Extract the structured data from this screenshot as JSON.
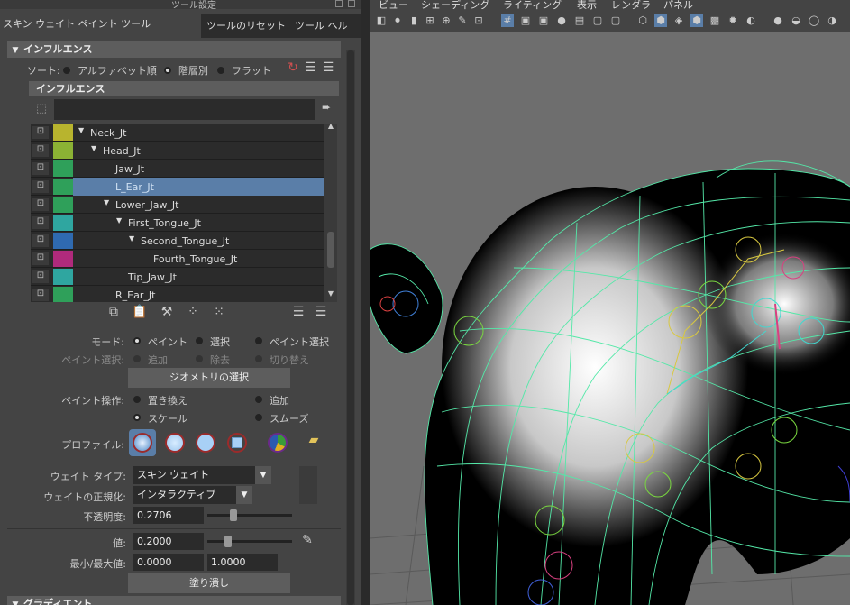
{
  "window": {
    "title": "ツール設定",
    "tool_name": "スキン ウェイト ペイント ツール",
    "reset_button": "ツールのリセット",
    "help_button": "ツール ヘルプ"
  },
  "influence": {
    "header": "インフルエンス",
    "sort_label": "ソート:",
    "sort_options": [
      "アルファベット順",
      "階層別",
      "フラット"
    ],
    "sort_selected": "階層別",
    "sub_header": "インフルエンス",
    "joints": [
      {
        "name": "Neck_Jt",
        "color": "#b8b42e",
        "indent": 1,
        "expand": true
      },
      {
        "name": "Head_Jt",
        "color": "#8bb234",
        "indent": 2,
        "expand": true
      },
      {
        "name": "Jaw_Jt",
        "color": "#2fa05a",
        "indent": 3,
        "expand": false
      },
      {
        "name": "L_Ear_Jt",
        "color": "#2fa05a",
        "indent": 3,
        "expand": false,
        "selected": true
      },
      {
        "name": "Lower_Jaw_Jt",
        "color": "#2fa05a",
        "indent": 3,
        "expand": true
      },
      {
        "name": "First_Tongue_Jt",
        "color": "#2fa6a0",
        "indent": 4,
        "expand": true
      },
      {
        "name": "Second_Tongue_Jt",
        "color": "#2f6ab0",
        "indent": 5,
        "expand": true
      },
      {
        "name": "Fourth_Tongue_Jt",
        "color": "#b02a7c",
        "indent": 6,
        "expand": false
      },
      {
        "name": "Tip_Jaw_Jt",
        "color": "#2fa6a0",
        "indent": 4,
        "expand": false
      },
      {
        "name": "R_Ear_Jt",
        "color": "#2fa05a",
        "indent": 3,
        "expand": false
      }
    ]
  },
  "mode": {
    "label": "モード:",
    "options": [
      "ペイント",
      "選択",
      "ペイント選択"
    ],
    "selected": "ペイント",
    "paint_select_label": "ペイント選択:",
    "paint_select_options": [
      "追加",
      "除去",
      "切り替え"
    ],
    "select_geometry_button": "ジオメトリの選択"
  },
  "paint_op": {
    "label": "ペイント操作:",
    "options": [
      "置き換え",
      "追加",
      "スケール",
      "スムーズ"
    ],
    "selected": "スケール"
  },
  "profile": {
    "label": "プロファイル:"
  },
  "weight_type": {
    "label": "ウェイト タイプ:",
    "value": "スキン ウェイト"
  },
  "normalize": {
    "label": "ウェイトの正規化:",
    "value": "インタラクティブ"
  },
  "opacity": {
    "label": "不透明度:",
    "value": "0.2706",
    "level": 0.27
  },
  "value": {
    "label": "値:",
    "value": "0.2000",
    "level": 0.2
  },
  "minmax": {
    "label": "最小/最大値:",
    "min": "0.0000",
    "max": "1.0000"
  },
  "flood_button": "塗り潰し",
  "gradient": {
    "header": "グラディエント"
  },
  "viewport": {
    "menus": [
      "ビュー",
      "シェーディング",
      "ライティング",
      "表示",
      "レンダラ",
      "パネル"
    ]
  }
}
